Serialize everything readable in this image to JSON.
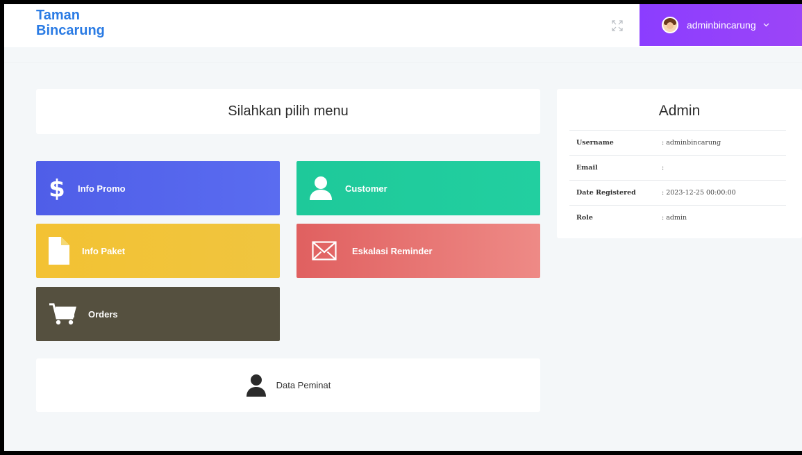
{
  "app": {
    "brand": "Taman\nBincarung"
  },
  "header": {
    "username": "adminbincarung",
    "icons": {
      "fullscreen": "fullscreen-icon",
      "avatar": "avatar",
      "dropdown": "chevron-down-icon"
    }
  },
  "main": {
    "menu_title": "Silahkan pilih menu",
    "tiles": [
      {
        "label": "Info Promo",
        "icon": "dollar-icon",
        "color": "#5563ec"
      },
      {
        "label": "Customer",
        "icon": "user-icon",
        "color": "#20cc9d"
      },
      {
        "label": "Info Paket",
        "icon": "file-icon",
        "color": "#f2c438"
      },
      {
        "label": "Eskalasi Reminder",
        "icon": "envelope-icon",
        "color": "#e77472"
      },
      {
        "label": "Orders",
        "icon": "cart-icon",
        "color": "#55503f"
      }
    ],
    "peminat": {
      "label": "Data Peminat",
      "icon": "user-icon"
    }
  },
  "admin_panel": {
    "title": "Admin",
    "rows": [
      {
        "key": "Username",
        "value": ": adminbincarung"
      },
      {
        "key": "Email",
        "value": ":"
      },
      {
        "key": "Date Registered",
        "value": ": 2023-12-25 00:00:00"
      },
      {
        "key": "Role",
        "value": ": admin"
      }
    ]
  },
  "colors": {
    "brand": "#2a7be4",
    "user_menu": "#9541fb",
    "background": "#f4f7f9"
  }
}
